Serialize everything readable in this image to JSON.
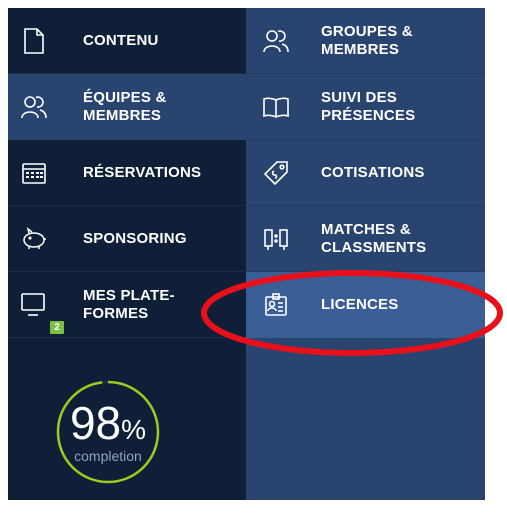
{
  "menu_left": [
    {
      "label": "CONTENU",
      "icon": "document-icon"
    },
    {
      "label": "ÉQUIPES &\nMEMBRES",
      "icon": "team-icon"
    },
    {
      "label": "RÉSERVATIONS",
      "icon": "calendar-icon"
    },
    {
      "label": "SPONSORING",
      "icon": "piggy-bank-icon"
    },
    {
      "label": "MES PLATE-\nFORMES",
      "icon": "monitor-icon",
      "badge": "2"
    }
  ],
  "menu_right": [
    {
      "label": "GROUPES &\nMEMBRES",
      "icon": "team-icon"
    },
    {
      "label": "SUIVI DES\nPRÉSENCES",
      "icon": "book-icon"
    },
    {
      "label": "COTISATIONS",
      "icon": "tag-icon"
    },
    {
      "label": "MATCHES &\nCLASSMENTS",
      "icon": "scoreboard-icon"
    },
    {
      "label": "LICENCES",
      "icon": "id-card-icon"
    }
  ],
  "completion": {
    "value": "98",
    "unit": "%",
    "label": "completion",
    "fraction": 0.98
  },
  "colors": {
    "panel": "#0f1f38",
    "active": "#2a4470",
    "selected": "#3a5f96",
    "accent_green": "#9ccc1f",
    "annotation_red": "#e8101a"
  }
}
